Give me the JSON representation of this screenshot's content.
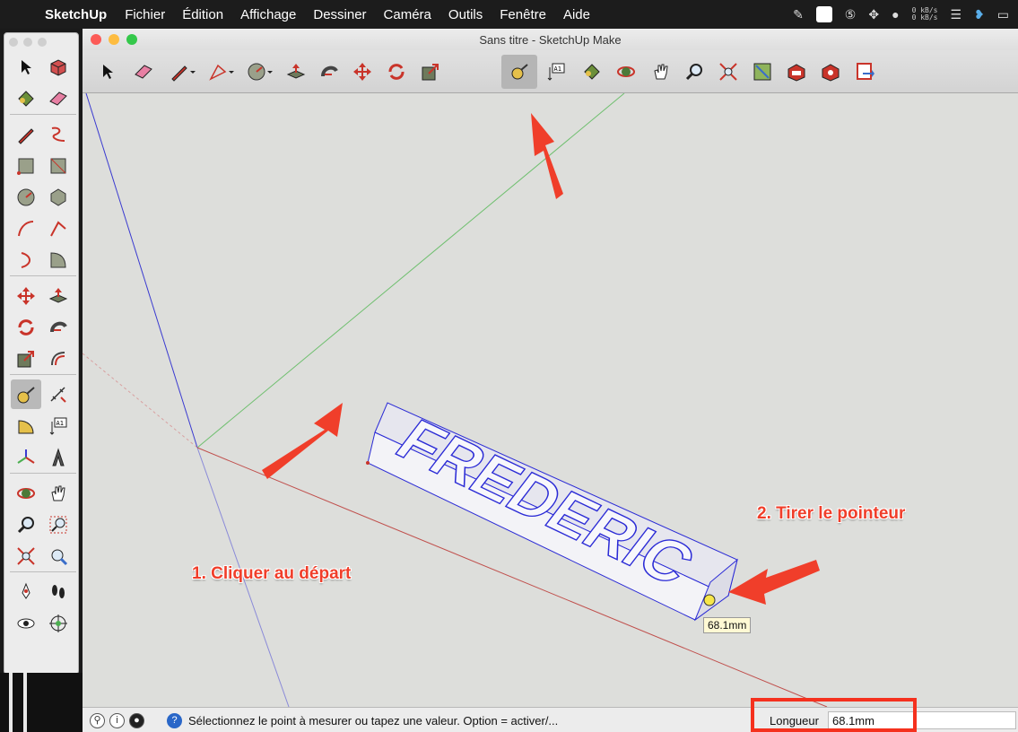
{
  "menubar": {
    "app": "SketchUp",
    "items": [
      "Fichier",
      "Édition",
      "Affichage",
      "Dessiner",
      "Caméra",
      "Outils",
      "Fenêtre",
      "Aide"
    ],
    "tray_rate_top": "0 kB/s",
    "tray_rate_bottom": "0 kB/s"
  },
  "window": {
    "title": "Sans titre - SketchUp Make"
  },
  "toolbar": {
    "tools": [
      "select-icon",
      "eraser-icon",
      "pencil-icon",
      "arc-icon",
      "circle-icon",
      "push-pull-icon",
      "follow-me-icon",
      "move-icon",
      "rotate-icon",
      "scale-icon",
      "tape-measure-icon",
      "text-icon",
      "paint-bucket-icon",
      "orbit-icon",
      "pan-icon",
      "zoom-icon",
      "zoom-extents-icon",
      "map-icon",
      "warehouse-icon",
      "extension-warehouse-icon",
      "layout-icon"
    ],
    "active": "tape-measure-icon"
  },
  "palette": {
    "active": "tape-measure-icon"
  },
  "viewport": {
    "model_text": "FREDERIC",
    "tooltip": "68.1mm"
  },
  "annotations": {
    "step1": "1. Cliquer au départ",
    "step2": "2. Tirer le pointeur"
  },
  "statusbar": {
    "message": "Sélectionnez le point à mesurer ou tapez une valeur.  Option = activer/...",
    "value_label": "Longueur",
    "value": "68.1mm"
  },
  "colors": {
    "annotation": "#f03e2a",
    "selection": "#2b2bd6",
    "axis_red": "#c0504d",
    "axis_green": "#4caf50",
    "axis_blue": "#3a3ad0"
  }
}
